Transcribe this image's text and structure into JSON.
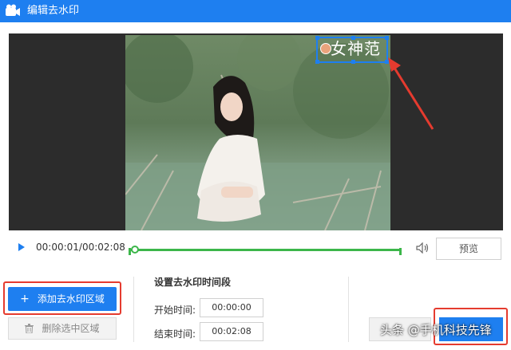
{
  "window": {
    "title": "编辑去水印"
  },
  "video": {
    "watermark_text": "女神范",
    "current_time": "00:00:01",
    "total_time": "00:02:08",
    "time_display": "00:00:01/00:02:08",
    "progress_fraction": 0.01
  },
  "controls": {
    "preview_label": "预览"
  },
  "left_panel": {
    "add_region_label": "添加去水印区域",
    "delete_region_label": "删除选中区域"
  },
  "time_settings": {
    "section_title": "设置去水印时间段",
    "start_label": "开始时间:",
    "start_value": "00:00:00",
    "end_label": "结束时间:",
    "end_value": "00:02:08"
  },
  "footer": {
    "overlay_text": "头条 @手机科技先锋"
  },
  "colors": {
    "accent": "#1e7ff0",
    "progress": "#3cb64a",
    "highlight": "#e53b2f"
  }
}
